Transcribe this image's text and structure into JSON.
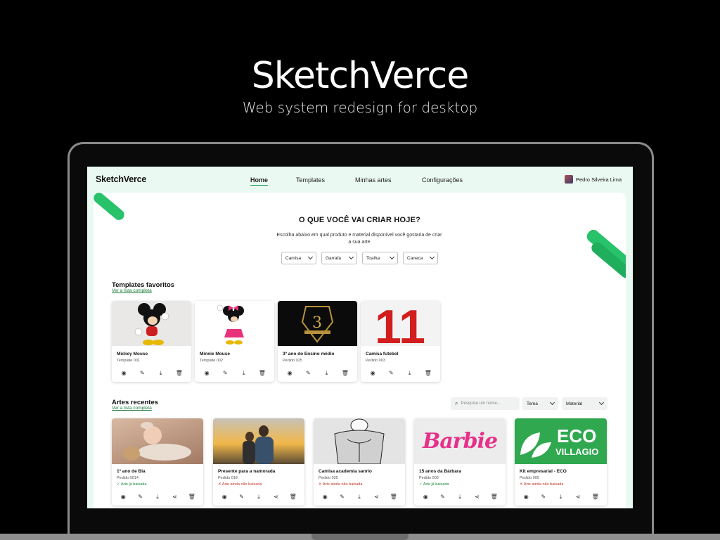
{
  "hero": {
    "title": "SketchVerce",
    "subtitle": "Web system redesign for desktop"
  },
  "app": {
    "logo": "SketchVerce",
    "nav": [
      {
        "label": "Home",
        "active": true
      },
      {
        "label": "Templates",
        "active": false
      },
      {
        "label": "Minhas artes",
        "active": false
      },
      {
        "label": "Configurações",
        "active": false
      }
    ],
    "user_name": "Pedro Silveira Lima"
  },
  "main": {
    "heading": "O QUE VOCÊ VAI CRIAR HOJE?",
    "subtext": "Escolha abaixo em qual produto e material disponível você gostaria de criar a sua arte",
    "product_selects": [
      "Camisa",
      "Garrafa",
      "Toalha",
      "Caneca"
    ]
  },
  "favorites": {
    "title": "Templates favoritos",
    "link": "Ver a lista completa",
    "items": [
      {
        "title": "Mickey Mouse",
        "code": "Template 001",
        "thumb": "mickey-mouse-image"
      },
      {
        "title": "Minnie Mouse",
        "code": "Template 002",
        "thumb": "minnie-mouse-image"
      },
      {
        "title": "3º ano do Ensino médio",
        "code": "Pedido 025",
        "thumb": "graduation-shirt-image"
      },
      {
        "title": "Camisa futebol",
        "code": "Pedido 003",
        "thumb": "number-11-image"
      }
    ]
  },
  "recent": {
    "title": "Artes recentes",
    "link": "Ver a lista completa",
    "search_placeholder": "Pesquise um nome...",
    "filters": [
      "Tema",
      "Material"
    ],
    "items": [
      {
        "title": "1º ano de Bia",
        "code": "Pedido 0014",
        "status": "Arte já baixada",
        "downloaded": true
      },
      {
        "title": "Presente para a namorada",
        "code": "Pedido 018",
        "status": "Arte ainda não baixada",
        "downloaded": false
      },
      {
        "title": "Camisa academia sanrio",
        "code": "Pedido 025",
        "status": "Arte ainda não baixada",
        "downloaded": false
      },
      {
        "title": "15 anos da Bárbara",
        "code": "Pedido 003",
        "status": "Arte já baixada",
        "downloaded": true
      },
      {
        "title": "Kit empresarial - ECO",
        "code": "Pedido 005",
        "status": "Arte ainda não baixada",
        "downloaded": false
      }
    ],
    "barbie_text": "Barbie",
    "eco_text_1": "ECO",
    "eco_text_2": "VILLAGIO",
    "number_text": "11",
    "graduation_text": "3"
  },
  "colors": {
    "accent": "#27c26a",
    "screen_bg": "#eafaf2",
    "ok": "#1a8a3a",
    "error": "#c0392b",
    "barbie": "#e6318a",
    "eco": "#2fa84f"
  }
}
